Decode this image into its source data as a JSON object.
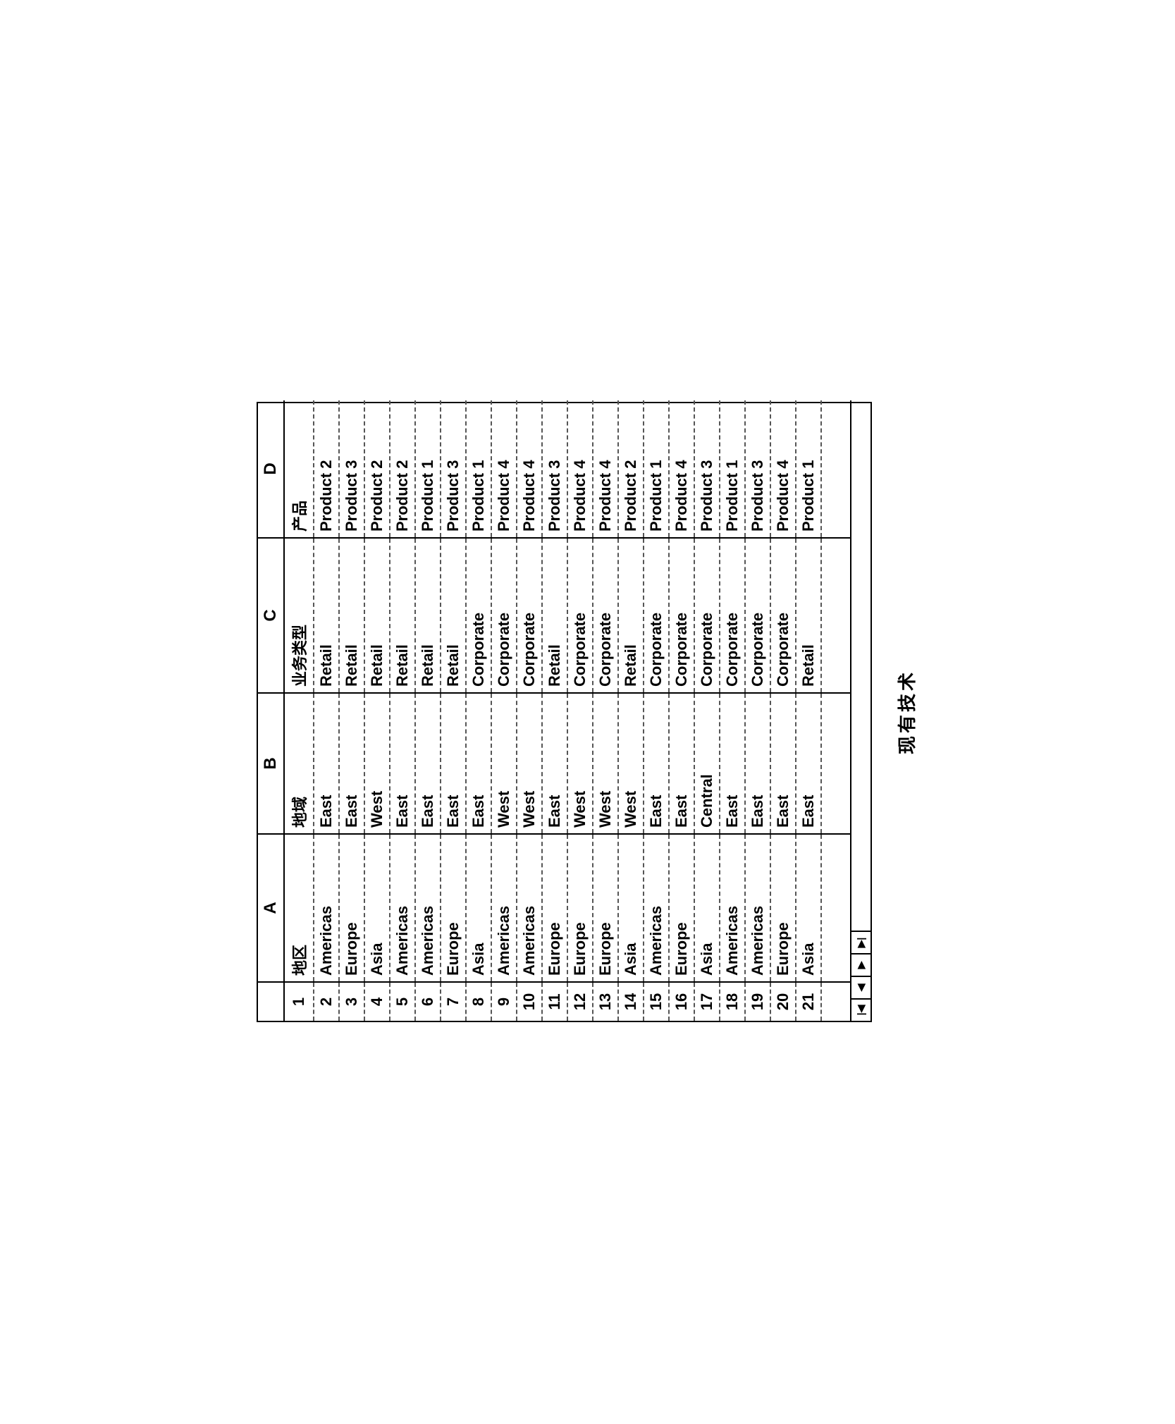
{
  "caption": "现有技术",
  "columns": {
    "rownum": "",
    "A": "A",
    "B": "B",
    "C": "C",
    "D": "D"
  },
  "headers": {
    "A": "地区",
    "B": "地域",
    "C": "业务类型",
    "D": "产品"
  },
  "nav": {
    "first": "|◀",
    "prev": "◀",
    "next": "▶",
    "last": "▶|"
  },
  "rows": [
    {
      "n": "1"
    },
    {
      "n": "2",
      "A": "Americas",
      "B": "East",
      "C": "Retail",
      "D": "Product 2"
    },
    {
      "n": "3",
      "A": "Europe",
      "B": "East",
      "C": "Retail",
      "D": "Product 3"
    },
    {
      "n": "4",
      "A": "Asia",
      "B": "West",
      "C": "Retail",
      "D": "Product 2"
    },
    {
      "n": "5",
      "A": "Americas",
      "B": "East",
      "C": "Retail",
      "D": "Product 2"
    },
    {
      "n": "6",
      "A": "Americas",
      "B": "East",
      "C": "Retail",
      "D": "Product 1"
    },
    {
      "n": "7",
      "A": "Europe",
      "B": "East",
      "C": "Retail",
      "D": "Product 3"
    },
    {
      "n": "8",
      "A": "Asia",
      "B": "East",
      "C": "Corporate",
      "D": "Product 1"
    },
    {
      "n": "9",
      "A": "Americas",
      "B": "West",
      "C": "Corporate",
      "D": "Product 4"
    },
    {
      "n": "10",
      "A": "Americas",
      "B": "West",
      "C": "Corporate",
      "D": "Product 4"
    },
    {
      "n": "11",
      "A": "Europe",
      "B": "East",
      "C": "Retail",
      "D": "Product 3"
    },
    {
      "n": "12",
      "A": "Europe",
      "B": "West",
      "C": "Corporate",
      "D": "Product 4"
    },
    {
      "n": "13",
      "A": "Europe",
      "B": "West",
      "C": "Corporate",
      "D": "Product 4"
    },
    {
      "n": "14",
      "A": "Asia",
      "B": "West",
      "C": "Retail",
      "D": "Product 2"
    },
    {
      "n": "15",
      "A": "Americas",
      "B": "East",
      "C": "Corporate",
      "D": "Product 1"
    },
    {
      "n": "16",
      "A": "Europe",
      "B": "East",
      "C": "Corporate",
      "D": "Product 4"
    },
    {
      "n": "17",
      "A": "Asia",
      "B": "Central",
      "C": "Corporate",
      "D": "Product 3"
    },
    {
      "n": "18",
      "A": "Americas",
      "B": "East",
      "C": "Corporate",
      "D": "Product 1"
    },
    {
      "n": "19",
      "A": "Americas",
      "B": "East",
      "C": "Corporate",
      "D": "Product 3"
    },
    {
      "n": "20",
      "A": "Europe",
      "B": "East",
      "C": "Corporate",
      "D": "Product 4"
    },
    {
      "n": "21",
      "A": "Asia",
      "B": "East",
      "C": "Retail",
      "D": "Product 1"
    }
  ]
}
